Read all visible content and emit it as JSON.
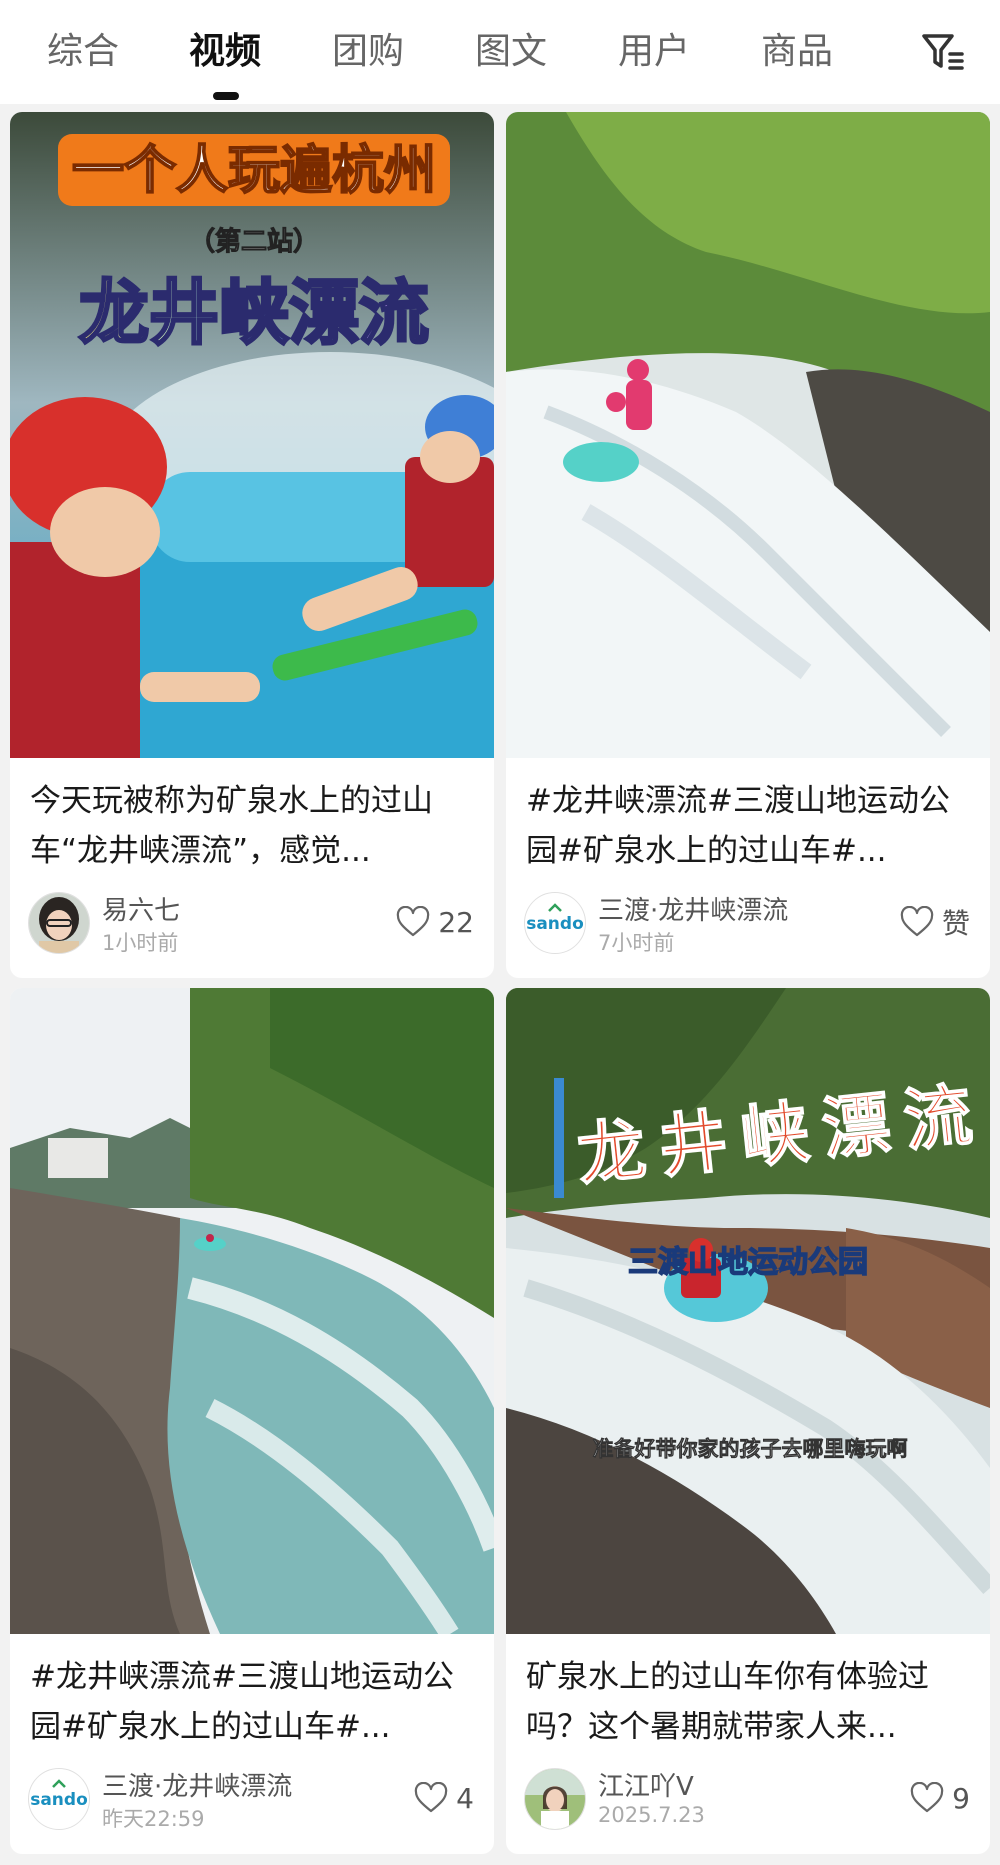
{
  "tabs": [
    {
      "label": "综合",
      "active": false
    },
    {
      "label": "视频",
      "active": true
    },
    {
      "label": "团购",
      "active": false
    },
    {
      "label": "图文",
      "active": false
    },
    {
      "label": "用户",
      "active": false
    },
    {
      "label": "商品",
      "active": false
    }
  ],
  "cards": [
    {
      "overlay_lines": [
        "一个人玩遍杭州",
        "（第二站）",
        "龙井峡漂流"
      ],
      "title": "今天玩被称为矿泉水上的过山车“龙井峡漂流”，感觉...",
      "author": "易六七",
      "time": "1小时前",
      "likes": "22"
    },
    {
      "title": "#龙井峡漂流#三渡山地运动公园#矿泉水上的过山车#...",
      "author": "三渡·龙井峡漂流",
      "time": "7小时前",
      "likes": "赞",
      "avatar_logo": "sando"
    },
    {
      "title": "#龙井峡漂流#三渡山地运动公园#矿泉水上的过山车#...",
      "author": "三渡·龙井峡漂流",
      "time": "昨天22:59",
      "likes": "4",
      "avatar_logo": "sando"
    },
    {
      "overlay_lines": [
        "龙井峡漂流",
        "三渡山地运动公园",
        "准备好带你家的孩子去哪里嗨玩啊"
      ],
      "title": "矿泉水上的过山车你有体验过吗？这个暑期就带家人来...",
      "author": "江江吖V",
      "time": "2025.7.23",
      "likes": "9"
    }
  ],
  "colors": {
    "accent": "#111111",
    "background": "#f2f2f2",
    "overlay_orange": "#f07a1a",
    "overlay_red": "#d8412b"
  }
}
